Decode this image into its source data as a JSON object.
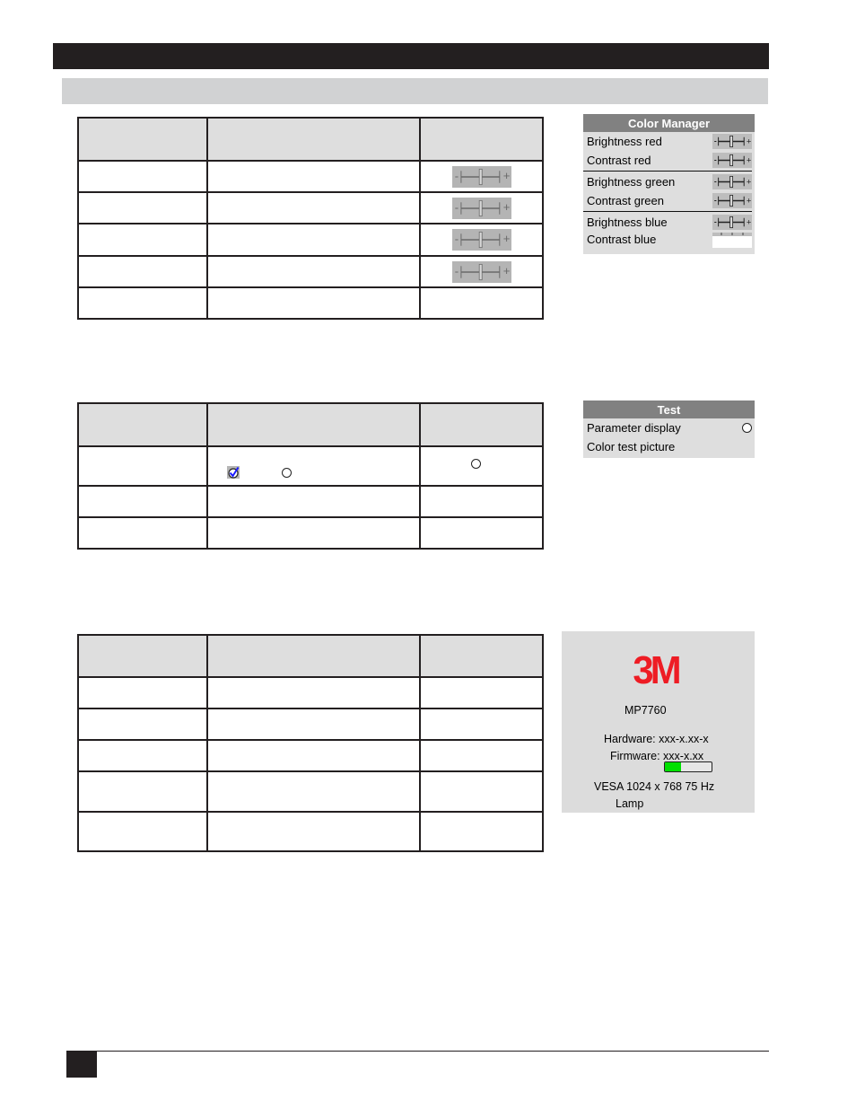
{
  "page": {
    "header_bar_label": "",
    "section_bar_label": "",
    "page_number": ""
  },
  "color_manager_table": {
    "header": [
      "",
      "",
      ""
    ],
    "rows": [
      {
        "c1": "",
        "c2": "",
        "control": "slider"
      },
      {
        "c1": "",
        "c2": "",
        "control": "slider"
      },
      {
        "c1": "",
        "c2": "",
        "control": "slider"
      },
      {
        "c1": "",
        "c2": "",
        "control": "slider"
      },
      {
        "c1": "",
        "c2": "",
        "control": "none"
      }
    ]
  },
  "color_manager_osd": {
    "title": "Color Manager",
    "items": [
      {
        "label": "Brightness red",
        "control": "slider"
      },
      {
        "label": "Contrast red",
        "control": "slider"
      },
      {
        "label": "Brightness green",
        "control": "slider"
      },
      {
        "label": "Contrast green",
        "control": "slider"
      },
      {
        "label": "Brightness blue",
        "control": "slider"
      },
      {
        "label": "Contrast blue",
        "control": "slider-partial"
      }
    ],
    "slider_minus": "-",
    "slider_plus": "+"
  },
  "test_table": {
    "header": [
      "",
      "",
      ""
    ],
    "rows": [
      {
        "c1": "",
        "c2": "",
        "c2_controls": [
          "checkbox-checked",
          "radio-empty"
        ],
        "control": "radio-empty"
      },
      {
        "c1": "",
        "c2": "",
        "control": "none"
      },
      {
        "c1": "",
        "c2": "",
        "control": "none"
      }
    ]
  },
  "test_osd": {
    "title": "Test",
    "items": [
      {
        "label": "Parameter display",
        "control": "radio-empty"
      },
      {
        "label": "Color test picture",
        "control": "none"
      }
    ]
  },
  "info_table": {
    "header": [
      "",
      "",
      ""
    ],
    "rows": [
      {
        "c1": "",
        "c2": "",
        "c3": ""
      },
      {
        "c1": "",
        "c2": "",
        "c3": ""
      },
      {
        "c1": "",
        "c2": "",
        "c3": ""
      },
      {
        "c1": "",
        "c2": "",
        "c3": ""
      },
      {
        "c1": "",
        "c2": "",
        "c3": ""
      }
    ]
  },
  "info_panel": {
    "logo": "3M",
    "model": "MP7760",
    "hardware": "Hardware: xxx-x.xx-x",
    "firmware": "Firmware: xxx-x.xx",
    "lamp_fill_fraction": 0.35,
    "video_mode": "VESA 1024 x 768  75 Hz",
    "lamp_label": "Lamp",
    "logo_color": "#ee1c24",
    "lamp_bar_color": "#00e000"
  }
}
